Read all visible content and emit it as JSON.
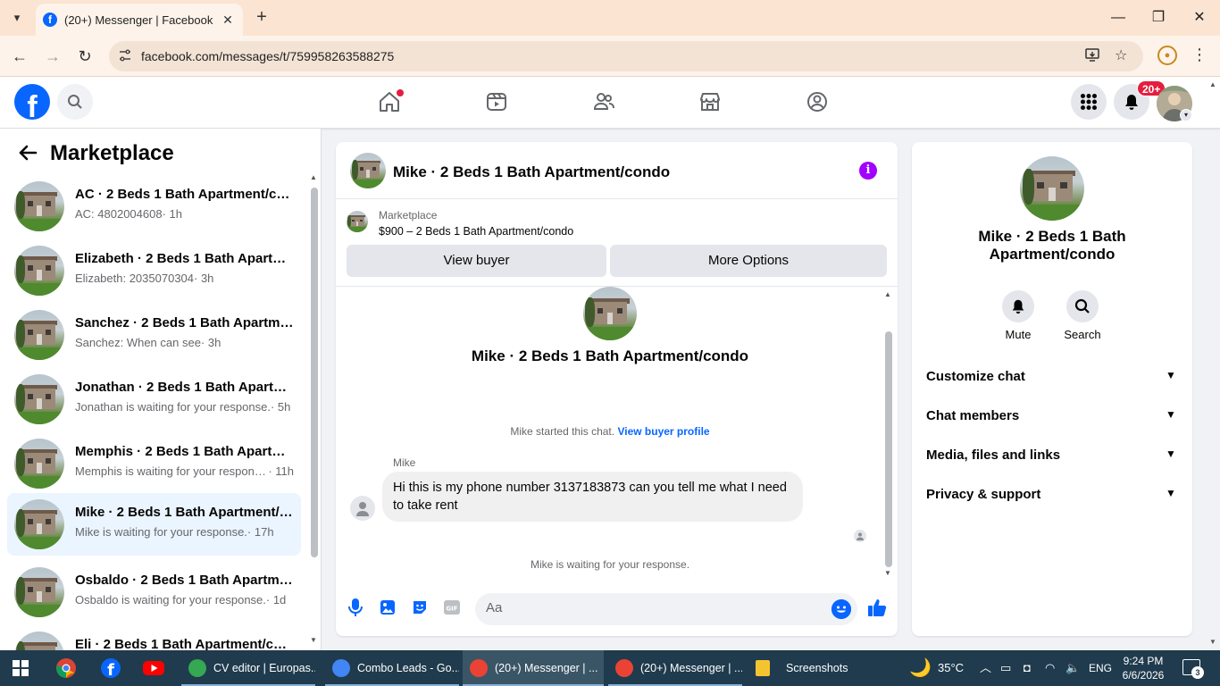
{
  "browser": {
    "tab_title": "(20+) Messenger | Facebook",
    "url": "facebook.com/messages/t/759958263588275"
  },
  "fbnav": {
    "notification_count": "20+"
  },
  "sidebar": {
    "title": "Marketplace",
    "conversations": [
      {
        "name": "AC · 2 Beds 1 Bath Apartment/condo",
        "preview": "AC: 4802004608",
        "time": " · 1h",
        "active": false
      },
      {
        "name": "Elizabeth · 2 Beds 1 Bath Apartment/condo",
        "preview": "Elizabeth: 2035070304",
        "time": " · 3h",
        "active": false
      },
      {
        "name": "Sanchez · 2 Beds 1 Bath Apartment/condo",
        "preview": "Sanchez: When can see",
        "time": " · 3h",
        "active": false
      },
      {
        "name": "Jonathan · 2 Beds 1 Bath Apartment/condo",
        "preview": "Jonathan is waiting for your response.",
        "time": " · 5h",
        "active": false
      },
      {
        "name": "Memphis · 2 Beds 1 Bath Apartment/condo",
        "preview": "Memphis is waiting for your response.",
        "time": " · 11h",
        "active": false
      },
      {
        "name": "Mike · 2 Beds 1 Bath Apartment/condo",
        "preview": "Mike is waiting for your response.",
        "time": " · 17h",
        "active": true
      },
      {
        "name": "Osbaldo · 2 Beds 1 Bath Apartment/condo",
        "preview": "Osbaldo is waiting for your response.",
        "time": " · 1d",
        "active": false
      },
      {
        "name": "Eli · 2 Beds 1 Bath Apartment/condo",
        "preview": "",
        "time": "",
        "active": false
      }
    ]
  },
  "chat": {
    "header_name": "Mike · 2 Beds 1 Bath Apartment/condo",
    "marketplace_label": "Marketplace",
    "listing": "$900 – 2 Beds 1 Bath Apartment/condo",
    "view_buyer": "View buyer",
    "more_options": "More Options",
    "intro_name": "Mike · 2 Beds 1 Bath Apartment/condo",
    "started_text": "Mike started this chat.",
    "view_profile": "View buyer profile",
    "sender": "Mike",
    "message": "Hi this is my phone number 3137183873 can you tell me what I need to take rent",
    "waiting": "Mike is waiting for your response.",
    "composer_placeholder": "Aa"
  },
  "rpanel": {
    "name": "Mike · 2 Beds 1 Bath Apartment/condo",
    "mute": "Mute",
    "search": "Search",
    "sections": [
      "Customize chat",
      "Chat members",
      "Media, files and links",
      "Privacy & support"
    ]
  },
  "taskbar": {
    "tasks": [
      {
        "label": "CV editor | Europas...",
        "color": "#34a853",
        "active": false
      },
      {
        "label": "Combo Leads - Go...",
        "color": "#4285f4",
        "active": false
      },
      {
        "label": "(20+) Messenger | ...",
        "color": "#ea4335",
        "active": true
      },
      {
        "label": "(20+) Messenger | ...",
        "color": "#ea4335",
        "active": false
      },
      {
        "label": "Screenshots",
        "color": "#f4c430",
        "active": false
      }
    ],
    "temperature": "35°C",
    "language": "ENG",
    "time": "9:24 PM",
    "date": "6/6/2026",
    "notifications": "3"
  }
}
